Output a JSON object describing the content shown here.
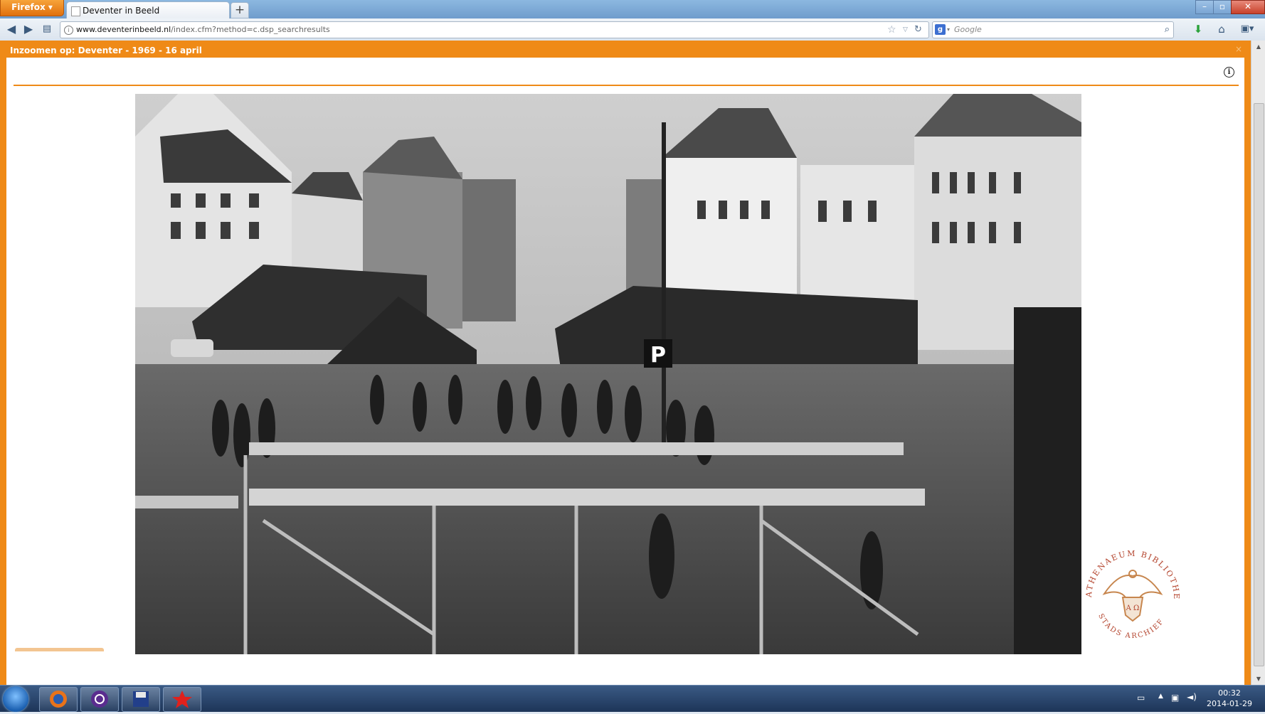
{
  "browser": {
    "menu_button_label": "Firefox",
    "tab_title": "Deventer in Beeld",
    "new_tab_label": "+",
    "url_host": "www.deventerinbeeld.nl",
    "url_path": "/index.cfm?method=c.dsp_searchresults",
    "search_placeholder": "Google",
    "search_engine_icon": "google-icon"
  },
  "page": {
    "zoom_title": "Inzoomen op: Deventer - 1969 - 16 april",
    "close_label": "×",
    "info_icon": "info-icon",
    "accent_color": "#ef8a17"
  },
  "watermark": {
    "top_text": "ATHENAEUM BIBLIOTHEEK",
    "bottom_text": "STADS ARCHIEF",
    "shield_text": "A Ω"
  },
  "taskbar": {
    "apps": [
      "firefox-icon",
      "media-player-icon",
      "floppy-save-icon",
      "red-star-app-icon"
    ],
    "clock_time": "00:32",
    "clock_date": "2014-01-29"
  }
}
